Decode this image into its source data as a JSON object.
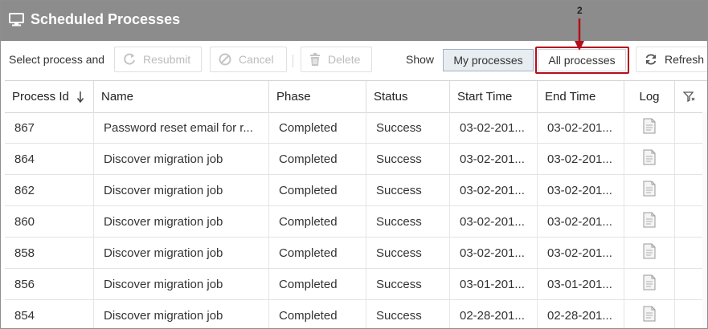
{
  "window": {
    "title": "Scheduled Processes",
    "icon": "monitor-icon"
  },
  "toolbar": {
    "select_label": "Select process and",
    "resubmit_label": "Resubmit",
    "cancel_label": "Cancel",
    "delete_label": "Delete",
    "show_label": "Show",
    "my_processes_label": "My processes",
    "all_processes_label": "All processes",
    "refresh_label": "Refresh",
    "callout_number": "2"
  },
  "table": {
    "headers": [
      "Process Id",
      "Name",
      "Phase",
      "Status",
      "Start Time",
      "End Time",
      "Log"
    ],
    "sort_indicator": "arrow-down-icon",
    "filter_icon": "filter-icon",
    "rows": [
      [
        "867",
        "Password reset email for r...",
        "Completed",
        "Success",
        "03-02-201...",
        "03-02-201..."
      ],
      [
        "864",
        "Discover migration job",
        "Completed",
        "Success",
        "03-02-201...",
        "03-02-201..."
      ],
      [
        "862",
        "Discover migration job",
        "Completed",
        "Success",
        "03-02-201...",
        "03-02-201..."
      ],
      [
        "860",
        "Discover migration job",
        "Completed",
        "Success",
        "03-02-201...",
        "03-02-201..."
      ],
      [
        "858",
        "Discover migration job",
        "Completed",
        "Success",
        "03-02-201...",
        "03-02-201..."
      ],
      [
        "856",
        "Discover migration job",
        "Completed",
        "Success",
        "03-01-201...",
        "03-01-201..."
      ],
      [
        "854",
        "Discover migration job",
        "Completed",
        "Success",
        "02-28-201...",
        "02-28-201..."
      ]
    ]
  },
  "colors": {
    "titlebar": "#8c8c8c",
    "highlight": "#b50d1c",
    "selected_segment": "#e8edf2"
  }
}
